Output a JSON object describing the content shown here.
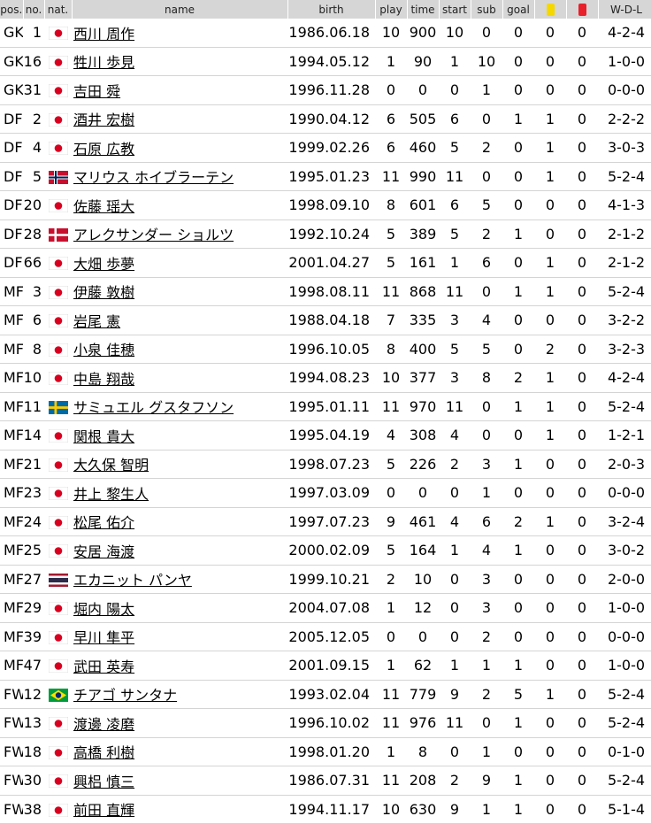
{
  "headers": {
    "pos": "pos.",
    "no": "no.",
    "nat": "nat.",
    "name": "name",
    "birth": "birth",
    "play": "play",
    "time": "time",
    "start": "start",
    "sub": "sub",
    "goal": "goal",
    "yellow_icon": "yellow-card-icon",
    "red_icon": "red-card-icon",
    "wdl": "W-D-L"
  },
  "colors": {
    "yellow_card": "#f5d800",
    "red_card": "#e8202a",
    "header_bg": "#d6d6d6"
  },
  "players": [
    {
      "pos": "GK",
      "no": "1",
      "nat": "japan",
      "name": "西川 周作",
      "birth": "1986.06.18",
      "play": "10",
      "time": "900",
      "start": "10",
      "sub": "0",
      "goal": "0",
      "yellow": "0",
      "red": "0",
      "wdl": "4-2-4"
    },
    {
      "pos": "GK",
      "no": "16",
      "nat": "japan",
      "name": "牲川 歩見",
      "birth": "1994.05.12",
      "play": "1",
      "time": "90",
      "start": "1",
      "sub": "10",
      "goal": "0",
      "yellow": "0",
      "red": "0",
      "wdl": "1-0-0"
    },
    {
      "pos": "GK",
      "no": "31",
      "nat": "japan",
      "name": "吉田 舜",
      "birth": "1996.11.28",
      "play": "0",
      "time": "0",
      "start": "0",
      "sub": "1",
      "goal": "0",
      "yellow": "0",
      "red": "0",
      "wdl": "0-0-0"
    },
    {
      "pos": "DF",
      "no": "2",
      "nat": "japan",
      "name": "酒井 宏樹",
      "birth": "1990.04.12",
      "play": "6",
      "time": "505",
      "start": "6",
      "sub": "0",
      "goal": "1",
      "yellow": "1",
      "red": "0",
      "wdl": "2-2-2"
    },
    {
      "pos": "DF",
      "no": "4",
      "nat": "japan",
      "name": "石原 広教",
      "birth": "1999.02.26",
      "play": "6",
      "time": "460",
      "start": "5",
      "sub": "2",
      "goal": "0",
      "yellow": "1",
      "red": "0",
      "wdl": "3-0-3"
    },
    {
      "pos": "DF",
      "no": "5",
      "nat": "norway",
      "name": "マリウス ホイブラーテン",
      "birth": "1995.01.23",
      "play": "11",
      "time": "990",
      "start": "11",
      "sub": "0",
      "goal": "0",
      "yellow": "1",
      "red": "0",
      "wdl": "5-2-4"
    },
    {
      "pos": "DF",
      "no": "20",
      "nat": "japan",
      "name": "佐藤 瑶大",
      "birth": "1998.09.10",
      "play": "8",
      "time": "601",
      "start": "6",
      "sub": "5",
      "goal": "0",
      "yellow": "0",
      "red": "0",
      "wdl": "4-1-3"
    },
    {
      "pos": "DF",
      "no": "28",
      "nat": "denmark",
      "name": "アレクサンダー ショルツ",
      "birth": "1992.10.24",
      "play": "5",
      "time": "389",
      "start": "5",
      "sub": "2",
      "goal": "1",
      "yellow": "0",
      "red": "0",
      "wdl": "2-1-2"
    },
    {
      "pos": "DF",
      "no": "66",
      "nat": "japan",
      "name": "大畑 歩夢",
      "birth": "2001.04.27",
      "play": "5",
      "time": "161",
      "start": "1",
      "sub": "6",
      "goal": "0",
      "yellow": "1",
      "red": "0",
      "wdl": "2-1-2"
    },
    {
      "pos": "MF",
      "no": "3",
      "nat": "japan",
      "name": "伊藤 敦樹",
      "birth": "1998.08.11",
      "play": "11",
      "time": "868",
      "start": "11",
      "sub": "0",
      "goal": "1",
      "yellow": "1",
      "red": "0",
      "wdl": "5-2-4"
    },
    {
      "pos": "MF",
      "no": "6",
      "nat": "japan",
      "name": "岩尾 憲",
      "birth": "1988.04.18",
      "play": "7",
      "time": "335",
      "start": "3",
      "sub": "4",
      "goal": "0",
      "yellow": "0",
      "red": "0",
      "wdl": "3-2-2"
    },
    {
      "pos": "MF",
      "no": "8",
      "nat": "japan",
      "name": "小泉 佳穂",
      "birth": "1996.10.05",
      "play": "8",
      "time": "400",
      "start": "5",
      "sub": "5",
      "goal": "0",
      "yellow": "2",
      "red": "0",
      "wdl": "3-2-3"
    },
    {
      "pos": "MF",
      "no": "10",
      "nat": "japan",
      "name": "中島 翔哉",
      "birth": "1994.08.23",
      "play": "10",
      "time": "377",
      "start": "3",
      "sub": "8",
      "goal": "2",
      "yellow": "1",
      "red": "0",
      "wdl": "4-2-4"
    },
    {
      "pos": "MF",
      "no": "11",
      "nat": "sweden",
      "name": "サミュエル グスタフソン",
      "birth": "1995.01.11",
      "play": "11",
      "time": "970",
      "start": "11",
      "sub": "0",
      "goal": "1",
      "yellow": "1",
      "red": "0",
      "wdl": "5-2-4"
    },
    {
      "pos": "MF",
      "no": "14",
      "nat": "japan",
      "name": "関根 貴大",
      "birth": "1995.04.19",
      "play": "4",
      "time": "308",
      "start": "4",
      "sub": "0",
      "goal": "0",
      "yellow": "1",
      "red": "0",
      "wdl": "1-2-1"
    },
    {
      "pos": "MF",
      "no": "21",
      "nat": "japan",
      "name": "大久保 智明",
      "birth": "1998.07.23",
      "play": "5",
      "time": "226",
      "start": "2",
      "sub": "3",
      "goal": "1",
      "yellow": "0",
      "red": "0",
      "wdl": "2-0-3"
    },
    {
      "pos": "MF",
      "no": "23",
      "nat": "japan",
      "name": "井上 黎生人",
      "birth": "1997.03.09",
      "play": "0",
      "time": "0",
      "start": "0",
      "sub": "1",
      "goal": "0",
      "yellow": "0",
      "red": "0",
      "wdl": "0-0-0"
    },
    {
      "pos": "MF",
      "no": "24",
      "nat": "japan",
      "name": "松尾 佑介",
      "birth": "1997.07.23",
      "play": "9",
      "time": "461",
      "start": "4",
      "sub": "6",
      "goal": "2",
      "yellow": "1",
      "red": "0",
      "wdl": "3-2-4"
    },
    {
      "pos": "MF",
      "no": "25",
      "nat": "japan",
      "name": "安居 海渡",
      "birth": "2000.02.09",
      "play": "5",
      "time": "164",
      "start": "1",
      "sub": "4",
      "goal": "1",
      "yellow": "0",
      "red": "0",
      "wdl": "3-0-2"
    },
    {
      "pos": "MF",
      "no": "27",
      "nat": "thailand",
      "name": "エカニット パンヤ",
      "birth": "1999.10.21",
      "play": "2",
      "time": "10",
      "start": "0",
      "sub": "3",
      "goal": "0",
      "yellow": "0",
      "red": "0",
      "wdl": "2-0-0"
    },
    {
      "pos": "MF",
      "no": "29",
      "nat": "japan",
      "name": "堀内 陽太",
      "birth": "2004.07.08",
      "play": "1",
      "time": "12",
      "start": "0",
      "sub": "3",
      "goal": "0",
      "yellow": "0",
      "red": "0",
      "wdl": "1-0-0"
    },
    {
      "pos": "MF",
      "no": "39",
      "nat": "japan",
      "name": "早川 隼平",
      "birth": "2005.12.05",
      "play": "0",
      "time": "0",
      "start": "0",
      "sub": "2",
      "goal": "0",
      "yellow": "0",
      "red": "0",
      "wdl": "0-0-0"
    },
    {
      "pos": "MF",
      "no": "47",
      "nat": "japan",
      "name": "武田 英寿",
      "birth": "2001.09.15",
      "play": "1",
      "time": "62",
      "start": "1",
      "sub": "1",
      "goal": "1",
      "yellow": "0",
      "red": "0",
      "wdl": "1-0-0"
    },
    {
      "pos": "FW",
      "no": "12",
      "nat": "brazil",
      "name": "チアゴ サンタナ",
      "birth": "1993.02.04",
      "play": "11",
      "time": "779",
      "start": "9",
      "sub": "2",
      "goal": "5",
      "yellow": "1",
      "red": "0",
      "wdl": "5-2-4"
    },
    {
      "pos": "FW",
      "no": "13",
      "nat": "japan",
      "name": "渡邊 凌磨",
      "birth": "1996.10.02",
      "play": "11",
      "time": "976",
      "start": "11",
      "sub": "0",
      "goal": "1",
      "yellow": "0",
      "red": "0",
      "wdl": "5-2-4"
    },
    {
      "pos": "FW",
      "no": "18",
      "nat": "japan",
      "name": "高橋 利樹",
      "birth": "1998.01.20",
      "play": "1",
      "time": "8",
      "start": "0",
      "sub": "1",
      "goal": "0",
      "yellow": "0",
      "red": "0",
      "wdl": "0-1-0"
    },
    {
      "pos": "FW",
      "no": "30",
      "nat": "japan",
      "name": "興梠 慎三",
      "birth": "1986.07.31",
      "play": "11",
      "time": "208",
      "start": "2",
      "sub": "9",
      "goal": "1",
      "yellow": "0",
      "red": "0",
      "wdl": "5-2-4"
    },
    {
      "pos": "FW",
      "no": "38",
      "nat": "japan",
      "name": "前田 直輝",
      "birth": "1994.11.17",
      "play": "10",
      "time": "630",
      "start": "9",
      "sub": "1",
      "goal": "1",
      "yellow": "0",
      "red": "0",
      "wdl": "5-1-4"
    }
  ]
}
